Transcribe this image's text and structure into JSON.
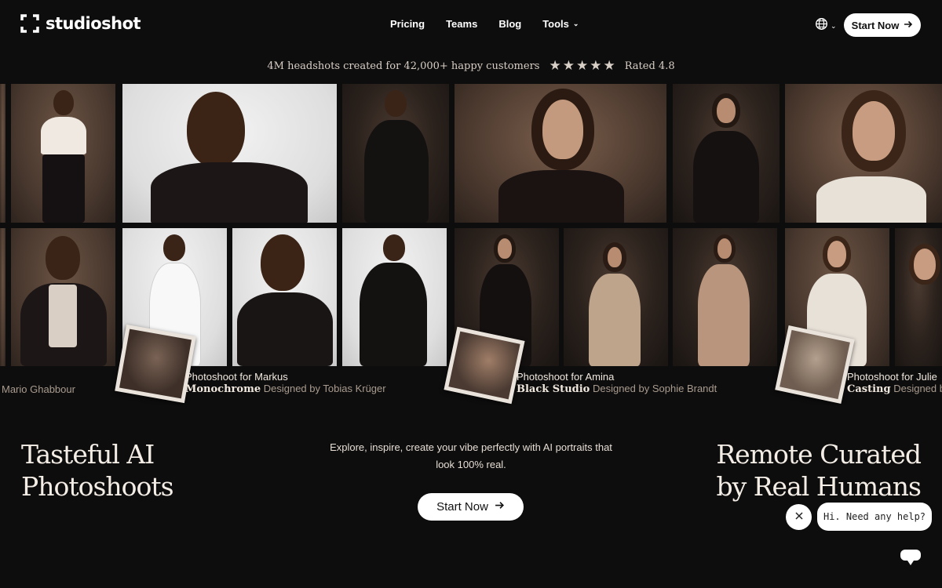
{
  "brand": {
    "name": "studioshot"
  },
  "nav": {
    "items": [
      {
        "label": "Pricing"
      },
      {
        "label": "Teams"
      },
      {
        "label": "Blog"
      },
      {
        "label": "Tools"
      }
    ],
    "language_icon": "globe-icon",
    "cta": "Start Now"
  },
  "rating": {
    "text": "4M headshots created for 42,000+ happy customers",
    "stars": 5,
    "label": "Rated 4.8"
  },
  "photoshoots": [
    {
      "title": "",
      "style": "",
      "designer": "Mario Ghabbour"
    },
    {
      "title": "Photoshoot for Markus",
      "style": "Monochrome",
      "designer": "Designed by Tobias Krüger"
    },
    {
      "title": "Photoshoot for Amina",
      "style": "Black Studio",
      "designer": "Designed by Sophie Brandt"
    },
    {
      "title": "Photoshoot for Julie",
      "style": "Casting",
      "designer": "Designed by"
    }
  ],
  "hero": {
    "left_line1": "Tasteful AI",
    "left_line2": "Photoshoots",
    "subtitle": "Explore, inspire, create your vibe perfectly with AI portraits that look 100% real.",
    "cta": "Start Now",
    "right_line1": "Remote Curated",
    "right_line2": "by Real Humans"
  },
  "chat": {
    "message": "Hi. Need any help?",
    "close_icon": "close-icon",
    "launcher_icon": "chat-icon"
  },
  "colors": {
    "background": "#0e0d0d",
    "text": "#f3ede6",
    "button_bg": "#ffffff",
    "button_text": "#111111"
  }
}
